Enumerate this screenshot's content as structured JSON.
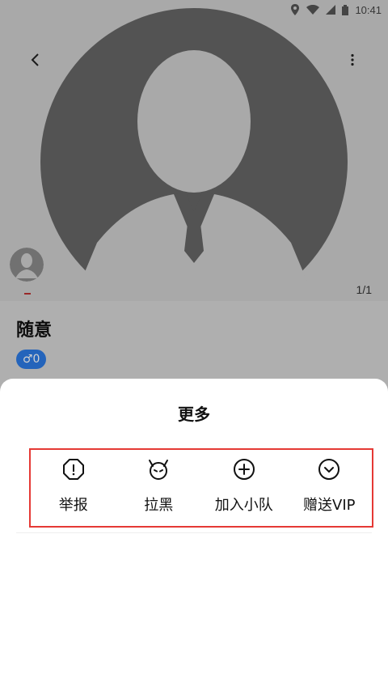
{
  "status_bar": {
    "time": "10:41",
    "icons": [
      "location-icon",
      "wifi-icon",
      "signal-icon",
      "battery-icon"
    ]
  },
  "header": {
    "back_icon": "back-arrow-icon",
    "more_icon": "more-vert-icon"
  },
  "profile": {
    "name": "随意",
    "gender_badge": "♂0",
    "pager": "1/1"
  },
  "sheet": {
    "title": "更多",
    "actions": [
      {
        "label": "举报",
        "icon": "warning-shield-icon"
      },
      {
        "label": "拉黑",
        "icon": "devil-icon"
      },
      {
        "label": "加入小队",
        "icon": "plus-circle-icon"
      },
      {
        "label": "赠送VIP",
        "icon": "chevron-down-circle-icon"
      }
    ]
  },
  "colors": {
    "accent_blue": "#2c7be5",
    "highlight_red": "#e53935",
    "placeholder_gray": "#666666"
  }
}
